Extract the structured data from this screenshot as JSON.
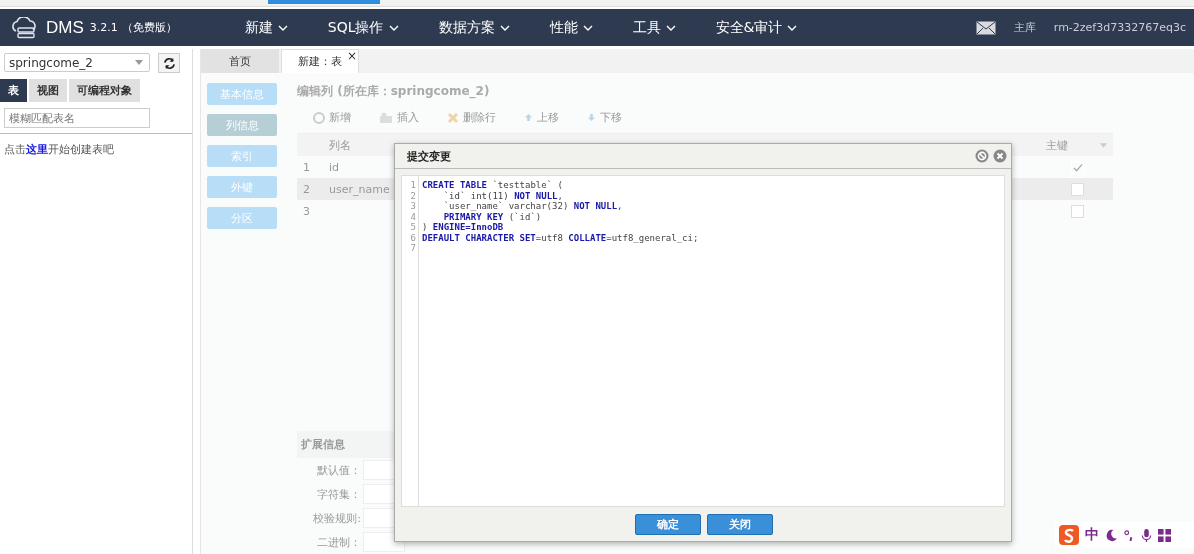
{
  "nav": {
    "product": "DMS",
    "version": "3.2.1",
    "edition": "（免费版）",
    "menus": [
      "新建",
      "SQL操作",
      "数据方案",
      "性能",
      "工具",
      "安全&审计"
    ],
    "role": "主库",
    "instance": "rm-2zef3d7332767eq3c"
  },
  "sidebar": {
    "database": "springcome_2",
    "tabs": [
      {
        "label": "表",
        "selected": true
      },
      {
        "label": "视图",
        "selected": false
      },
      {
        "label": "可编程对象",
        "selected": false
      }
    ],
    "search": {
      "placeholder": "模糊匹配表名"
    },
    "hint": {
      "before": "点击",
      "link": "这里",
      "after": "开始创建表吧"
    }
  },
  "tabs": [
    {
      "label": "首页",
      "selected": false
    },
    {
      "label": "新建：表",
      "selected": true,
      "close": "×"
    }
  ],
  "sections": [
    {
      "label": "基本信息",
      "selected": false
    },
    {
      "label": "列信息",
      "selected": true
    },
    {
      "label": "索引",
      "selected": false
    },
    {
      "label": "外键",
      "selected": false
    },
    {
      "label": "分区",
      "selected": false
    }
  ],
  "editor": {
    "title": "编辑列 (所在库：springcome_2)",
    "toolbar": [
      {
        "kind": "add",
        "label": "新增"
      },
      {
        "kind": "insert",
        "label": "插入"
      },
      {
        "kind": "delete",
        "label": "删除行"
      },
      {
        "kind": "up",
        "label": "上移"
      },
      {
        "kind": "down",
        "label": "下移"
      }
    ],
    "columns": {
      "name": "列名",
      "primary": "主键"
    },
    "rows": [
      {
        "number": "1",
        "name": "id",
        "primary": true,
        "selected": false
      },
      {
        "number": "2",
        "name": "user_name",
        "primary": false,
        "selected": true
      },
      {
        "number": "3",
        "primary": false,
        "selected": false
      }
    ]
  },
  "extended": {
    "title": "扩展信息",
    "fields": [
      "默认值：",
      "字符集：",
      "校验规则:",
      "二进制："
    ]
  },
  "dialog": {
    "title": "提交变更",
    "code": [
      {
        "number": "1",
        "tokens": [
          {
            "kind": "keyword",
            "text": "CREATE TABLE"
          },
          {
            "kind": "plain",
            "text": " `testtable` ("
          }
        ]
      },
      {
        "number": "2",
        "indented": true,
        "tokens": [
          {
            "kind": "plain",
            "text": "`id` int(11) "
          },
          {
            "kind": "keyword",
            "text": "NOT NULL"
          },
          {
            "kind": "plain",
            "text": ","
          }
        ]
      },
      {
        "number": "3",
        "indented": true,
        "tokens": [
          {
            "kind": "plain",
            "text": "`user_name` varchar(32) "
          },
          {
            "kind": "keyword",
            "text": "NOT NULL"
          },
          {
            "kind": "plain",
            "text": ","
          }
        ]
      },
      {
        "number": "4",
        "indented": true,
        "tokens": [
          {
            "kind": "keyword",
            "text": "PRIMARY KEY"
          },
          {
            "kind": "plain",
            "text": " (`id`)"
          }
        ]
      },
      {
        "number": "5",
        "tokens": [
          {
            "kind": "plain",
            "text": ") "
          },
          {
            "kind": "keyword",
            "text": "ENGINE=InnoDB"
          }
        ]
      },
      {
        "number": "6",
        "tokens": [
          {
            "kind": "keyword",
            "text": "DEFAULT CHARACTER SET"
          },
          {
            "kind": "plain",
            "text": "=utf8 "
          },
          {
            "kind": "keyword",
            "text": "COLLATE"
          },
          {
            "kind": "plain",
            "text": "=utf8_general_ci;"
          }
        ]
      },
      {
        "number": "7"
      }
    ],
    "buttons": [
      "确定",
      "关闭"
    ]
  },
  "ime": {
    "mode": "中"
  }
}
